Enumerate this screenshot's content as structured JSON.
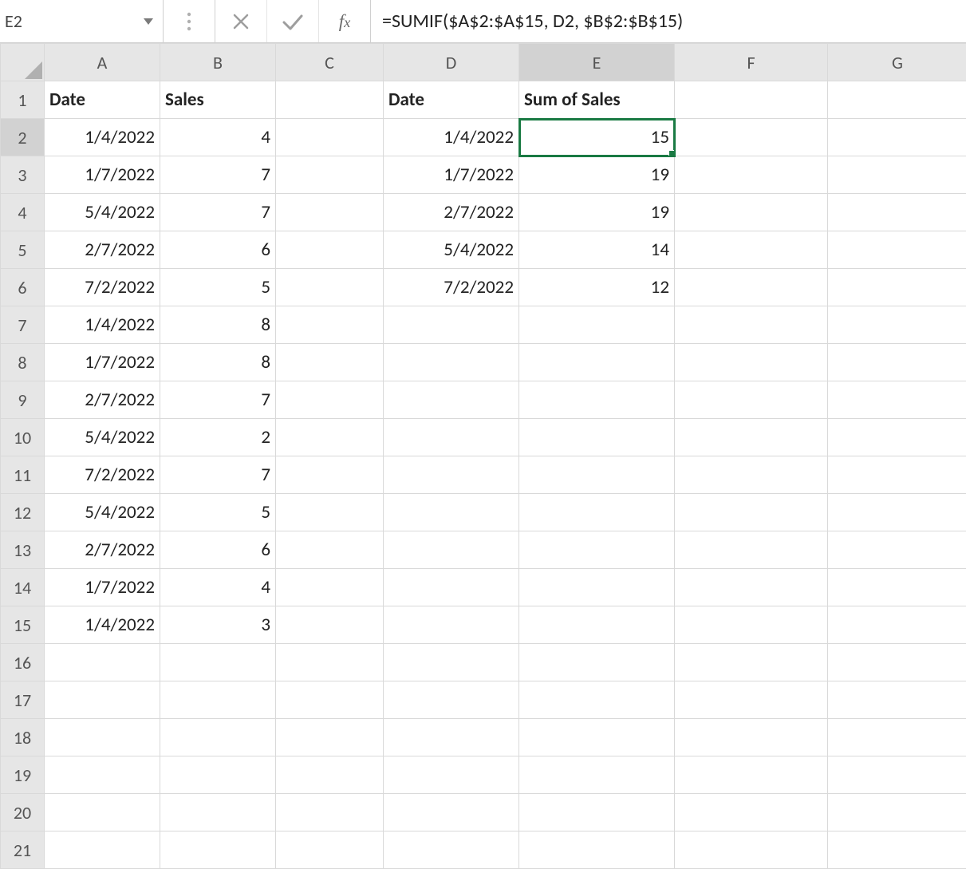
{
  "nameBox": "E2",
  "formula": "=SUMIF($A$2:$A$15, D2, $B$2:$B$15)",
  "columns": [
    "A",
    "B",
    "C",
    "D",
    "E",
    "F",
    "G"
  ],
  "selectedColIndex": 4,
  "selectedRowIndex": 1,
  "selectedCell": {
    "row": 1,
    "col": 4
  },
  "numRows": 21,
  "rows": [
    {
      "A": {
        "v": "Date",
        "bold": true,
        "align": "text"
      },
      "B": {
        "v": "Sales",
        "bold": true,
        "align": "text"
      },
      "C": {
        "v": ""
      },
      "D": {
        "v": "Date",
        "bold": true,
        "align": "text"
      },
      "E": {
        "v": "Sum of Sales",
        "bold": true,
        "align": "text"
      }
    },
    {
      "A": {
        "v": "1/4/2022",
        "align": "num"
      },
      "B": {
        "v": "4",
        "align": "num"
      },
      "C": {
        "v": ""
      },
      "D": {
        "v": "1/4/2022",
        "align": "num"
      },
      "E": {
        "v": "15",
        "align": "num"
      }
    },
    {
      "A": {
        "v": "1/7/2022",
        "align": "num"
      },
      "B": {
        "v": "7",
        "align": "num"
      },
      "C": {
        "v": ""
      },
      "D": {
        "v": "1/7/2022",
        "align": "num"
      },
      "E": {
        "v": "19",
        "align": "num"
      }
    },
    {
      "A": {
        "v": "5/4/2022",
        "align": "num"
      },
      "B": {
        "v": "7",
        "align": "num"
      },
      "C": {
        "v": ""
      },
      "D": {
        "v": "2/7/2022",
        "align": "num"
      },
      "E": {
        "v": "19",
        "align": "num"
      }
    },
    {
      "A": {
        "v": "2/7/2022",
        "align": "num"
      },
      "B": {
        "v": "6",
        "align": "num"
      },
      "C": {
        "v": ""
      },
      "D": {
        "v": "5/4/2022",
        "align": "num"
      },
      "E": {
        "v": "14",
        "align": "num"
      }
    },
    {
      "A": {
        "v": "7/2/2022",
        "align": "num"
      },
      "B": {
        "v": "5",
        "align": "num"
      },
      "C": {
        "v": ""
      },
      "D": {
        "v": "7/2/2022",
        "align": "num"
      },
      "E": {
        "v": "12",
        "align": "num"
      }
    },
    {
      "A": {
        "v": "1/4/2022",
        "align": "num"
      },
      "B": {
        "v": "8",
        "align": "num"
      },
      "C": {
        "v": ""
      },
      "D": {
        "v": ""
      },
      "E": {
        "v": ""
      }
    },
    {
      "A": {
        "v": "1/7/2022",
        "align": "num"
      },
      "B": {
        "v": "8",
        "align": "num"
      },
      "C": {
        "v": ""
      },
      "D": {
        "v": ""
      },
      "E": {
        "v": ""
      }
    },
    {
      "A": {
        "v": "2/7/2022",
        "align": "num"
      },
      "B": {
        "v": "7",
        "align": "num"
      },
      "C": {
        "v": ""
      },
      "D": {
        "v": ""
      },
      "E": {
        "v": ""
      }
    },
    {
      "A": {
        "v": "5/4/2022",
        "align": "num"
      },
      "B": {
        "v": "2",
        "align": "num"
      },
      "C": {
        "v": ""
      },
      "D": {
        "v": ""
      },
      "E": {
        "v": ""
      }
    },
    {
      "A": {
        "v": "7/2/2022",
        "align": "num"
      },
      "B": {
        "v": "7",
        "align": "num"
      },
      "C": {
        "v": ""
      },
      "D": {
        "v": ""
      },
      "E": {
        "v": ""
      }
    },
    {
      "A": {
        "v": "5/4/2022",
        "align": "num"
      },
      "B": {
        "v": "5",
        "align": "num"
      },
      "C": {
        "v": ""
      },
      "D": {
        "v": ""
      },
      "E": {
        "v": ""
      }
    },
    {
      "A": {
        "v": "2/7/2022",
        "align": "num"
      },
      "B": {
        "v": "6",
        "align": "num"
      },
      "C": {
        "v": ""
      },
      "D": {
        "v": ""
      },
      "E": {
        "v": ""
      }
    },
    {
      "A": {
        "v": "1/7/2022",
        "align": "num"
      },
      "B": {
        "v": "4",
        "align": "num"
      },
      "C": {
        "v": ""
      },
      "D": {
        "v": ""
      },
      "E": {
        "v": ""
      }
    },
    {
      "A": {
        "v": "1/4/2022",
        "align": "num"
      },
      "B": {
        "v": "3",
        "align": "num"
      },
      "C": {
        "v": ""
      },
      "D": {
        "v": ""
      },
      "E": {
        "v": ""
      }
    }
  ]
}
